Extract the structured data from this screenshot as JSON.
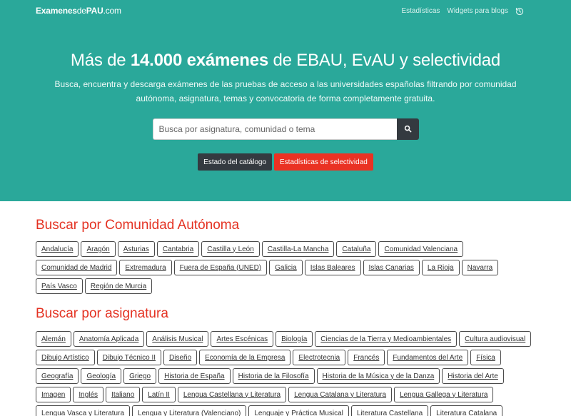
{
  "brand": {
    "part1": "Examenes",
    "part2": "de",
    "part3": "PAU",
    "part4": ".com"
  },
  "nav": {
    "items": [
      "Estadísticas",
      "Widgets para blogs"
    ],
    "history_icon": "history-icon"
  },
  "hero": {
    "title_pre": "Más de ",
    "title_bold": "14.000 exámenes",
    "title_post": " de EBAU, EvAU y selectividad",
    "subtitle": "Busca, encuentra y descarga exámenes de las pruebas de acceso a las universidades españolas filtrando por comunidad autónoma, asignatura, temas y convocatoria de forma completamente gratuita.",
    "search_placeholder": "Busca por asignatura, comunidad o tema",
    "search_icon": "search-icon",
    "btn_catalog": "Estado del catálogo",
    "btn_stats": "Estadísticas de selectividad"
  },
  "colors": {
    "hero_bg": "#2aa89a",
    "accent_red": "#e43222",
    "dark_button": "#343a40"
  },
  "communities": {
    "title": "Buscar por Comunidad Autónoma",
    "items": [
      "Andalucía",
      "Aragón",
      "Asturias",
      "Cantabria",
      "Castilla y León",
      "Castilla-La Mancha",
      "Cataluña",
      "Comunidad Valenciana",
      "Comunidad de Madrid",
      "Extremadura",
      "Fuera de España (UNED)",
      "Galicia",
      "Islas Baleares",
      "Islas Canarias",
      "La Rioja",
      "Navarra",
      "País Vasco",
      "Región de Murcia"
    ]
  },
  "subjects": {
    "title": "Buscar por asignatura",
    "items": [
      "Alemán",
      "Anatomía Aplicada",
      "Análisis Musical",
      "Artes Escénicas",
      "Biología",
      "Ciencias de la Tierra y Medioambientales",
      "Cultura audiovisual",
      "Dibujo Artístico",
      "Dibujo Técnico II",
      "Diseño",
      "Economía de la Empresa",
      "Electrotecnia",
      "Francés",
      "Fundamentos del Arte",
      "Física",
      "Geografía",
      "Geología",
      "Griego",
      "Historia de España",
      "Historia de la Filosofía",
      "Historia de la Música y de la Danza",
      "Historia del Arte",
      "Imagen",
      "Inglés",
      "Italiano",
      "Latín II",
      "Lengua Castellana y Literatura",
      "Lengua Catalana y Literatura",
      "Lengua Gallega y Literatura",
      "Lengua Vasca y Literatura",
      "Lengua y Literatura (Valenciano)",
      "Lenguaje y Práctica Musical",
      "Literatura Castellana",
      "Literatura Catalana"
    ]
  }
}
